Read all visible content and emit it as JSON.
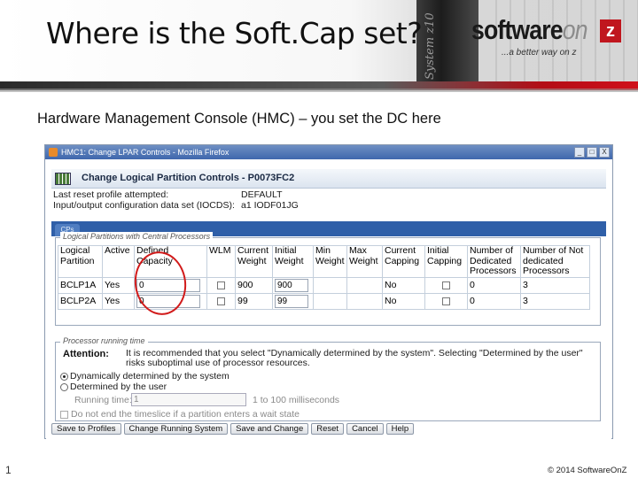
{
  "slide": {
    "title": "Where is the Soft.Cap set?",
    "subtitle": "Hardware Management Console (HMC) – you set the DC here",
    "number": "1",
    "copyright": "© 2014 SoftwareOnZ"
  },
  "logo": {
    "text_main": "software",
    "text_on": "on",
    "z": "z",
    "tagline": "...a better way on z",
    "machine_label": "System z10"
  },
  "browser": {
    "window_title": "HMC1: Change LPAR Controls - Mozilla Firefox",
    "buttons": [
      "_",
      "□",
      "X"
    ]
  },
  "dialog": {
    "title": "Change Logical Partition Controls - P0073FC2",
    "last_reset_label": "Last reset profile attempted:",
    "last_reset_value": "DEFAULT",
    "iocds_label": "Input/output configuration data set (IOCDS):",
    "iocds_value": "a1 IODF01JG",
    "tab_label": "CPs",
    "lp_section_legend": "Logical Partitions with Central Processors",
    "columns": [
      "Logical Partition",
      "Active",
      "Defined Capacity",
      "WLM",
      "Current Weight",
      "Initial Weight",
      "Min Weight",
      "Max Weight",
      "Current Capping",
      "Initial Capping",
      "Number of Dedicated Processors",
      "Number of Not dedicated Processors"
    ],
    "rows": [
      {
        "partition": "BCLP1A",
        "active": "Yes",
        "defined_capacity": "0",
        "current_weight": "900",
        "initial_weight": "900",
        "min_weight": "",
        "max_weight": "",
        "current_capping": "No",
        "dedicated": "0",
        "not_dedicated": "3"
      },
      {
        "partition": "BCLP2A",
        "active": "Yes",
        "defined_capacity": "0",
        "current_weight": "99",
        "initial_weight": "99",
        "min_weight": "",
        "max_weight": "",
        "current_capping": "No",
        "dedicated": "0",
        "not_dedicated": "3"
      }
    ],
    "prt_section_legend": "Processor running time",
    "attention_label": "Attention:",
    "attention_text": "It is recommended that you select \"Dynamically determined by the system\". Selecting \"Determined by the user\" risks suboptimal use of processor resources.",
    "radio_dynamic": "Dynamically determined by the system",
    "radio_user": "Determined by the user",
    "running_time_label": "Running time:",
    "running_time_value": "1",
    "running_time_range": "1 to 100 milliseconds",
    "wait_state_label": "Do not end the timeslice if a partition enters a wait state",
    "actions": [
      "Save to Profiles",
      "Change Running System",
      "Save and Change",
      "Reset",
      "Cancel",
      "Help"
    ]
  },
  "colors": {
    "accent_red": "#c0161e",
    "titlebar_blue": "#3f67ad",
    "tab_blue": "#2f5fa8",
    "annotation_red": "#d11a1a"
  }
}
